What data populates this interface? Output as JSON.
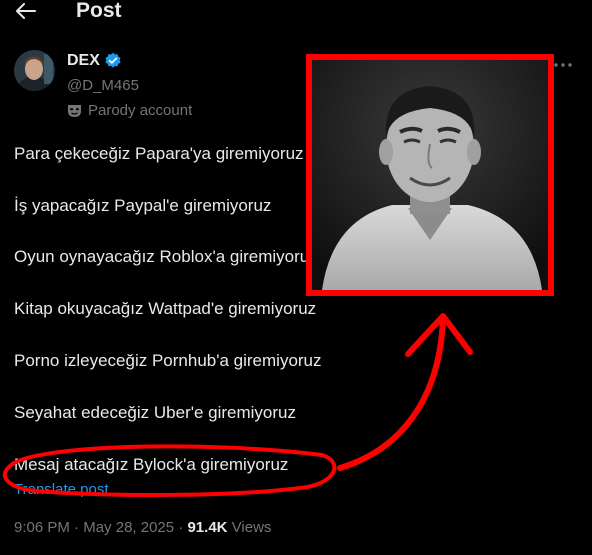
{
  "header": {
    "title": "Post",
    "back_icon": "arrow-left-icon"
  },
  "author": {
    "name": "DEX",
    "handle": "@D_M465",
    "parody_label": "Parody account",
    "verified_color": "#1d9bf0"
  },
  "post": {
    "lines": [
      "Para çekeceğiz Papara'ya giremiyoruz",
      "İş yapacağız Paypal'e giremiyoruz",
      "Oyun oynayacağız Roblox'a giremiyoruz",
      "Kitap okuyacağız Wattpad'e giremiyoruz",
      "Porno izleyeceğiz Pornhub'a giremiyoruz",
      "Seyahat edeceğiz Uber'e giremiyoruz",
      "Mesaj atacağız Bylock'a giremiyoruz"
    ],
    "translate_label": "Translate post"
  },
  "meta": {
    "time": "9:06 PM",
    "separator": " · ",
    "date": "May 28, 2025",
    "views_count": "91.4K",
    "views_label": " Views"
  },
  "annotation": {
    "color": "#ff0000"
  }
}
